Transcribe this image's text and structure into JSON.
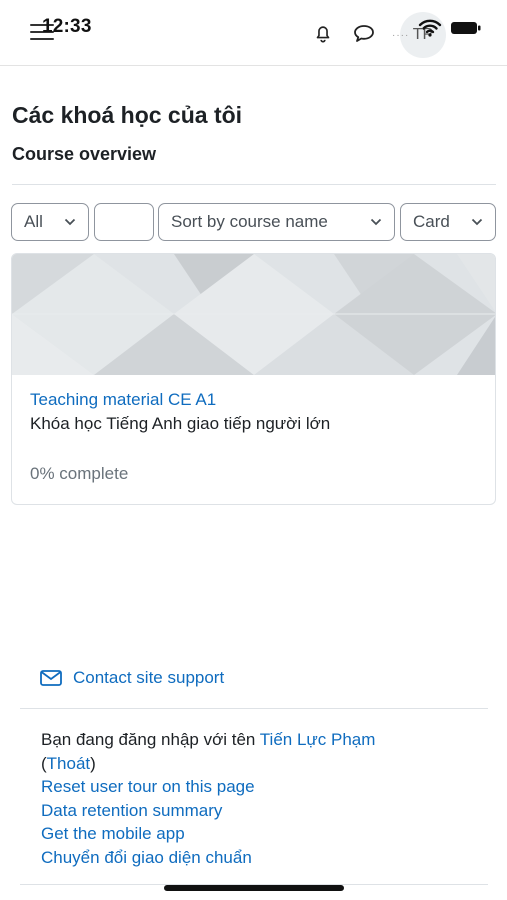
{
  "status_bar": {
    "time": "12:33",
    "avatar_initials": "TP"
  },
  "icons": {
    "menu": "hamburger-icon",
    "notifications": "bell-icon",
    "messages": "chat-icon",
    "wifi": "wifi-icon",
    "battery": "battery-icon",
    "mail": "envelope-icon"
  },
  "page": {
    "title": "Các khoá học của tôi",
    "section": "Course overview"
  },
  "filters": {
    "grouping": "All",
    "search_value": "",
    "sort": "Sort by course name",
    "view": "Card"
  },
  "course": {
    "name": "Teaching material CE A1",
    "summary": "Khóa học Tiếng Anh giao tiếp người lớn",
    "progress_text": "0% complete",
    "progress_value": 0
  },
  "footer": {
    "support": "Contact site support",
    "logged_in_prefix": "Bạn đang đăng nhập với tên ",
    "user_name": "Tiến Lực Phạm",
    "open_paren": "(",
    "logout": "Thoát",
    "close_paren": ")",
    "links": [
      "Reset user tour on this page",
      "Data retention summary",
      "Get the mobile app",
      "Chuyển đổi giao diện chuẩn"
    ]
  },
  "colors": {
    "link": "#0f6cbf",
    "text": "#1d2125",
    "muted": "#6a737b",
    "border": "#dee2e6"
  }
}
